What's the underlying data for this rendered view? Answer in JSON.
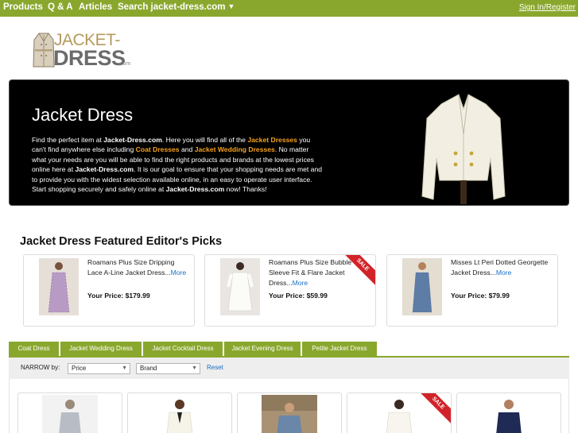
{
  "nav": {
    "items": [
      "Products",
      "Q & A",
      "Articles",
      "Search jacket-dress.com"
    ],
    "signin": "Sign In/Register"
  },
  "logo": {
    "line1": "JACKET-",
    "line2": "DRESS",
    "line3": ".com"
  },
  "hero": {
    "title": "Jacket Dress",
    "p1": "Find the perfect item at ",
    "site1": "Jacket-Dress.com",
    "p2": ". Here you will find all of the ",
    "link1": "Jacket Dresses",
    "p3": " you can't find anywhere else including ",
    "link2": "Coat Dresses",
    "p4": " and ",
    "link3": "Jacket Wedding Dresses",
    "p5": ". No matter what your needs are you will be able to find the right products and brands at the lowest prices online here at ",
    "site2": "Jacket-Dress.com",
    "p6": ". It is our goal to ensure that your shopping needs are met and to provide you with the widest selection available online, in an easy to operate user interface. Start shopping securely and safely online at ",
    "site3": "Jacket-Dress.com",
    "p7": " now! Thanks!"
  },
  "picks": {
    "title": "Jacket Dress Featured Editor's Picks",
    "items": [
      {
        "name": "Roamans Plus Size Dripping Lace A-Line Jacket Dress...",
        "more": "More",
        "price": "Your Price: $179.99",
        "sale": ""
      },
      {
        "name": "Roamans Plus Size Bubble Sleeve Fit & Flare Jacket Dress...",
        "more": "More",
        "price": "Your Price: $59.99",
        "sale": "SALE"
      },
      {
        "name": "Misses Lt Peri Dotted Georgette Jacket Dress...",
        "more": "More",
        "price": "Your Price: $79.99",
        "sale": ""
      }
    ]
  },
  "tabs": [
    "Coat Dress",
    "Jacket Wedding Dress",
    "Jacket Cocktail Dress",
    "Jacket Evening Dress",
    "Petite Jacket Dress"
  ],
  "narrow": {
    "label": "NARROW by:",
    "price": "Price",
    "brand": "Brand",
    "reset": "Reset"
  },
  "grid": {
    "sale": "SALE"
  },
  "colors": {
    "accent_green": "#8aa72d",
    "sale_red": "#d2232a",
    "hero_highlight": "#f7a21b",
    "link_blue": "#1a6fc4"
  }
}
